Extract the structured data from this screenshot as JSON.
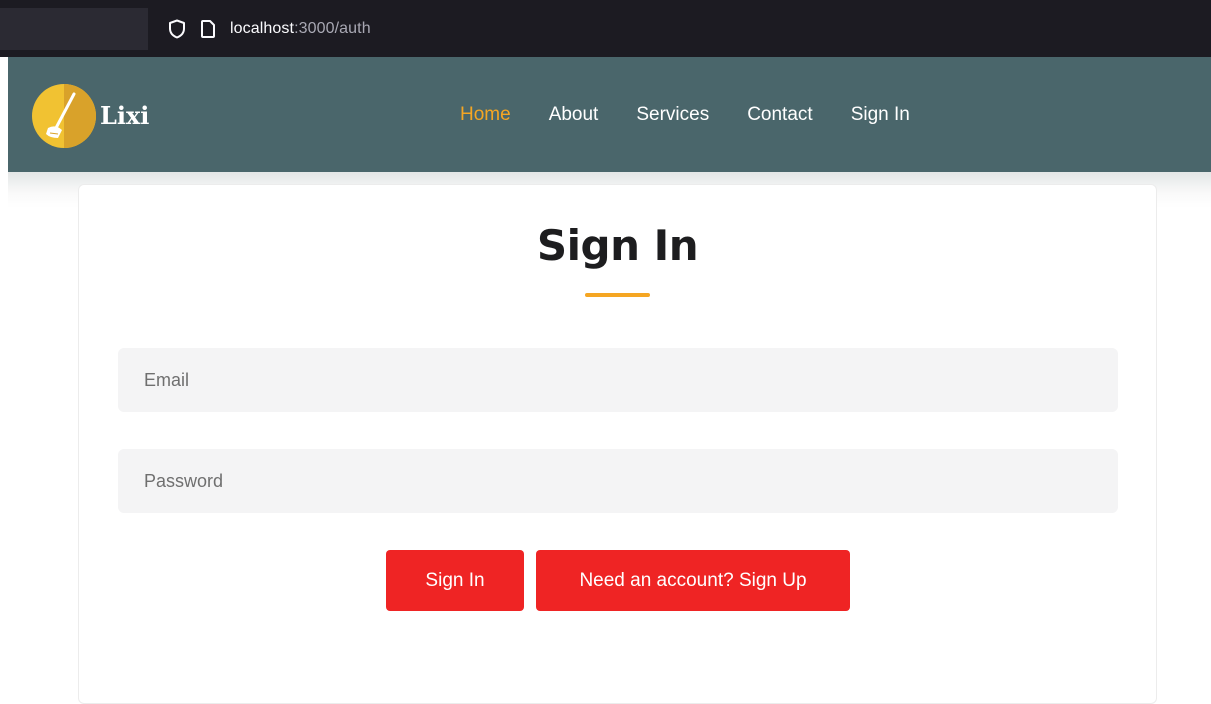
{
  "browser": {
    "url_host": "localhost",
    "url_rest": ":3000/auth",
    "icons": [
      "shield-icon",
      "page-icon"
    ]
  },
  "header": {
    "logo_text": "Lixi",
    "logo_icon": "broom-icon",
    "nav": [
      {
        "label": "Home",
        "active": true
      },
      {
        "label": "About",
        "active": false
      },
      {
        "label": "Services",
        "active": false
      },
      {
        "label": "Contact",
        "active": false
      },
      {
        "label": "Sign In",
        "active": false
      }
    ]
  },
  "form": {
    "title": "Sign In",
    "email_placeholder": "Email",
    "email_value": "",
    "password_placeholder": "Password",
    "password_value": "",
    "signin_label": "Sign In",
    "signup_label": "Need an account? Sign Up"
  },
  "colors": {
    "header_bg": "#4a666b",
    "accent": "#f5a623",
    "button": "#ef2424",
    "input_bg": "#f4f4f5"
  }
}
